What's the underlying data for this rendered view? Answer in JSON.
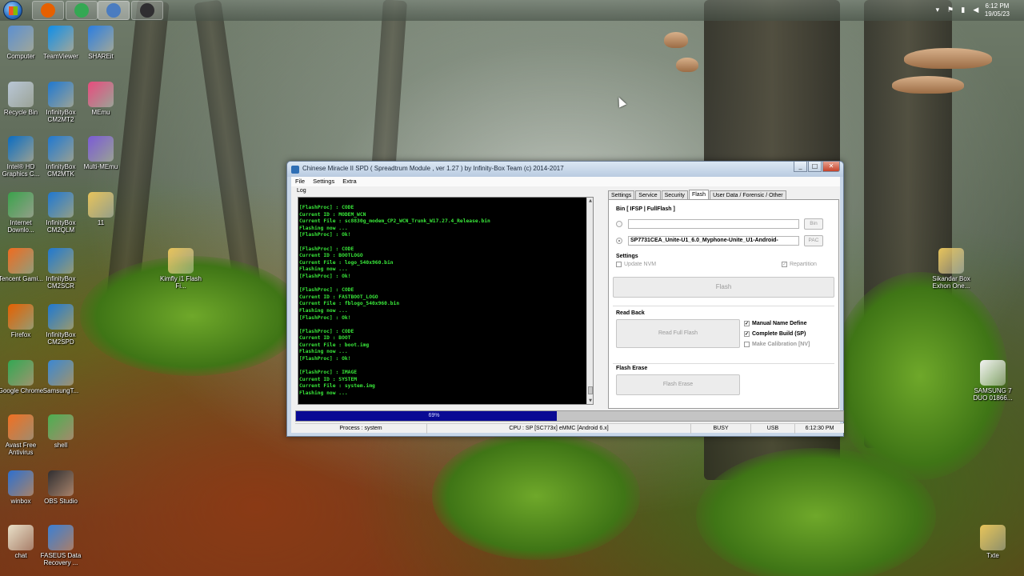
{
  "taskbar": {
    "apps": [
      {
        "icon": "firefox-icon",
        "color": "#e66000",
        "active": false
      },
      {
        "icon": "chrome-icon",
        "color": "#34a853",
        "active": false
      },
      {
        "icon": "spd-icon",
        "color": "#4a7cc0",
        "active": true
      },
      {
        "icon": "obs-icon",
        "color": "#302e31",
        "active": false
      }
    ],
    "clock_time": "6:12 PM",
    "clock_date": "19/05/23"
  },
  "desktop": {
    "icons": [
      {
        "label": "Computer",
        "icon": "computer-icon",
        "color": "#5b8fd1"
      },
      {
        "label": "TeamViewer",
        "icon": "teamviewer-icon",
        "color": "#0e8ee9"
      },
      {
        "label": "SHAREit",
        "icon": "shareit-icon",
        "color": "#2a7de1"
      },
      {
        "label": "Recycle Bin",
        "icon": "recycle-bin-icon",
        "color": "#b9c7d6"
      },
      {
        "label": "InfinityBox CM2MT2",
        "icon": "infinitybox-icon",
        "color": "#1f78d1"
      },
      {
        "label": "MEmu",
        "icon": "memu-icon",
        "color": "#e94b7d"
      },
      {
        "label": "Intel® HD Graphics C...",
        "icon": "intel-icon",
        "color": "#0a6cc2"
      },
      {
        "label": "InfinityBox CM2MTK",
        "icon": "infinitybox-icon",
        "color": "#1f78d1"
      },
      {
        "label": "Multi-MEmu",
        "icon": "multi-memu-icon",
        "color": "#7b5bd6"
      },
      {
        "label": "Internet Downlo...",
        "icon": "idm-icon",
        "color": "#3aa34a"
      },
      {
        "label": "InfinityBox CM2QLM",
        "icon": "infinitybox-icon",
        "color": "#1f78d1"
      },
      {
        "label": "11",
        "icon": "folder-icon",
        "color": "#e8c45a"
      },
      {
        "label": "Kimfly i1 Flash Fi...",
        "icon": "folder-icon",
        "color": "#e8c45a"
      },
      {
        "label": "Tencent Gami...",
        "icon": "tencent-icon",
        "color": "#f06b1e"
      },
      {
        "label": "InfinityBox CM2SCR",
        "icon": "infinitybox-icon",
        "color": "#1f78d1"
      },
      {
        "label": "Firefox",
        "icon": "firefox-icon",
        "color": "#e66000"
      },
      {
        "label": "InfinityBox CM2SPD",
        "icon": "infinitybox-icon",
        "color": "#1f78d1"
      },
      {
        "label": "Google Chrome",
        "icon": "chrome-icon",
        "color": "#34a853"
      },
      {
        "label": "SamsungT...",
        "icon": "samsung-tool-icon",
        "color": "#3c87d3"
      },
      {
        "label": "Avast Free Antivirus",
        "icon": "avast-icon",
        "color": "#f26f21"
      },
      {
        "label": "shell",
        "icon": "shell-icon",
        "color": "#4caf50"
      },
      {
        "label": "winbox",
        "icon": "winbox-icon",
        "color": "#2e6fcf"
      },
      {
        "label": "OBS Studio",
        "icon": "obs-icon",
        "color": "#302e31"
      },
      {
        "label": "chat",
        "icon": "chat-file-icon",
        "color": "#e9e0c8"
      },
      {
        "label": "FASEUS Data Recovery ...",
        "icon": "easeus-icon",
        "color": "#3b7fd4"
      },
      {
        "label": "Sikandar Box Exhon One...",
        "icon": "folder-icon",
        "color": "#e8c45a"
      },
      {
        "label": "SAMSUNG 7 DUO 01866...",
        "icon": "document-icon",
        "color": "#f2f2f2"
      },
      {
        "label": "Txte",
        "icon": "folder-icon",
        "color": "#e8c45a"
      }
    ]
  },
  "window": {
    "title": "Chinese Miracle II SPD ( Spreadtrum Module , ver 1.27 ) by Infinity-Box Team (c) 2014-2017",
    "menu": [
      "File",
      "Settings",
      "Extra"
    ],
    "log_label": "Log",
    "log_lines": [
      "[FlashProc] : CODE",
      "Current ID : MODEM_WCN",
      "Current File : sc8830g_modem_CP2_WCN_Trunk_W17.27.4_Release.bin",
      "Flashing now ...",
      "[FlashProc] : Ok!",
      "",
      "[FlashProc] : CODE",
      "Current ID : BOOTLOGO",
      "Current File : logo_540x960.bin",
      "Flashing now ...",
      "[FlashProc] : Ok!",
      "",
      "[FlashProc] : CODE",
      "Current ID : FASTBOOT_LOGO",
      "Current File : fblogo_540x960.bin",
      "Flashing now ...",
      "[FlashProc] : Ok!",
      "",
      "[FlashProc] : CODE",
      "Current ID : BOOT",
      "Current File : boot.img",
      "Flashing now ...",
      "[FlashProc] : Ok!",
      "",
      "[FlashProc] : IMAGE",
      "Current ID : SYSTEM",
      "Current File : system.img",
      "Flashing now ..."
    ],
    "tabs": [
      "Settings",
      "Service",
      "Security",
      "Flash",
      "User Data / Forensic / Other"
    ],
    "active_tab": "Flash",
    "flash": {
      "bin_group": "Bin  [ IFSP | FullFlash ]",
      "bin_value": "",
      "bin_button": "Bin",
      "pac_value": "SP7731CEA_Unite-U1_6.0_Myphone-Unite_U1-Android-",
      "pac_button": "PAC",
      "settings_group": "Settings",
      "update_nvm": "Update NVM",
      "repartition": "Repartition",
      "flash_button": "Flash",
      "readback_group": "Read Back",
      "read_full_flash": "Read Full Flash",
      "manual_name": "Manual Name Define",
      "complete_build": "Complete Build (SP)",
      "make_calibration": "Make Calibration [NV]",
      "erase_group": "Flash Erase",
      "flash_erase_button": "Flash Erase"
    },
    "progress_percent": 69,
    "progress_text": "69%",
    "status": {
      "process": "Process : system",
      "cpu": "CPU : SP [SC773x] eMMC [Android 6.x]",
      "state": "BUSY",
      "port": "USB",
      "time": "6:12:30 PM"
    }
  }
}
